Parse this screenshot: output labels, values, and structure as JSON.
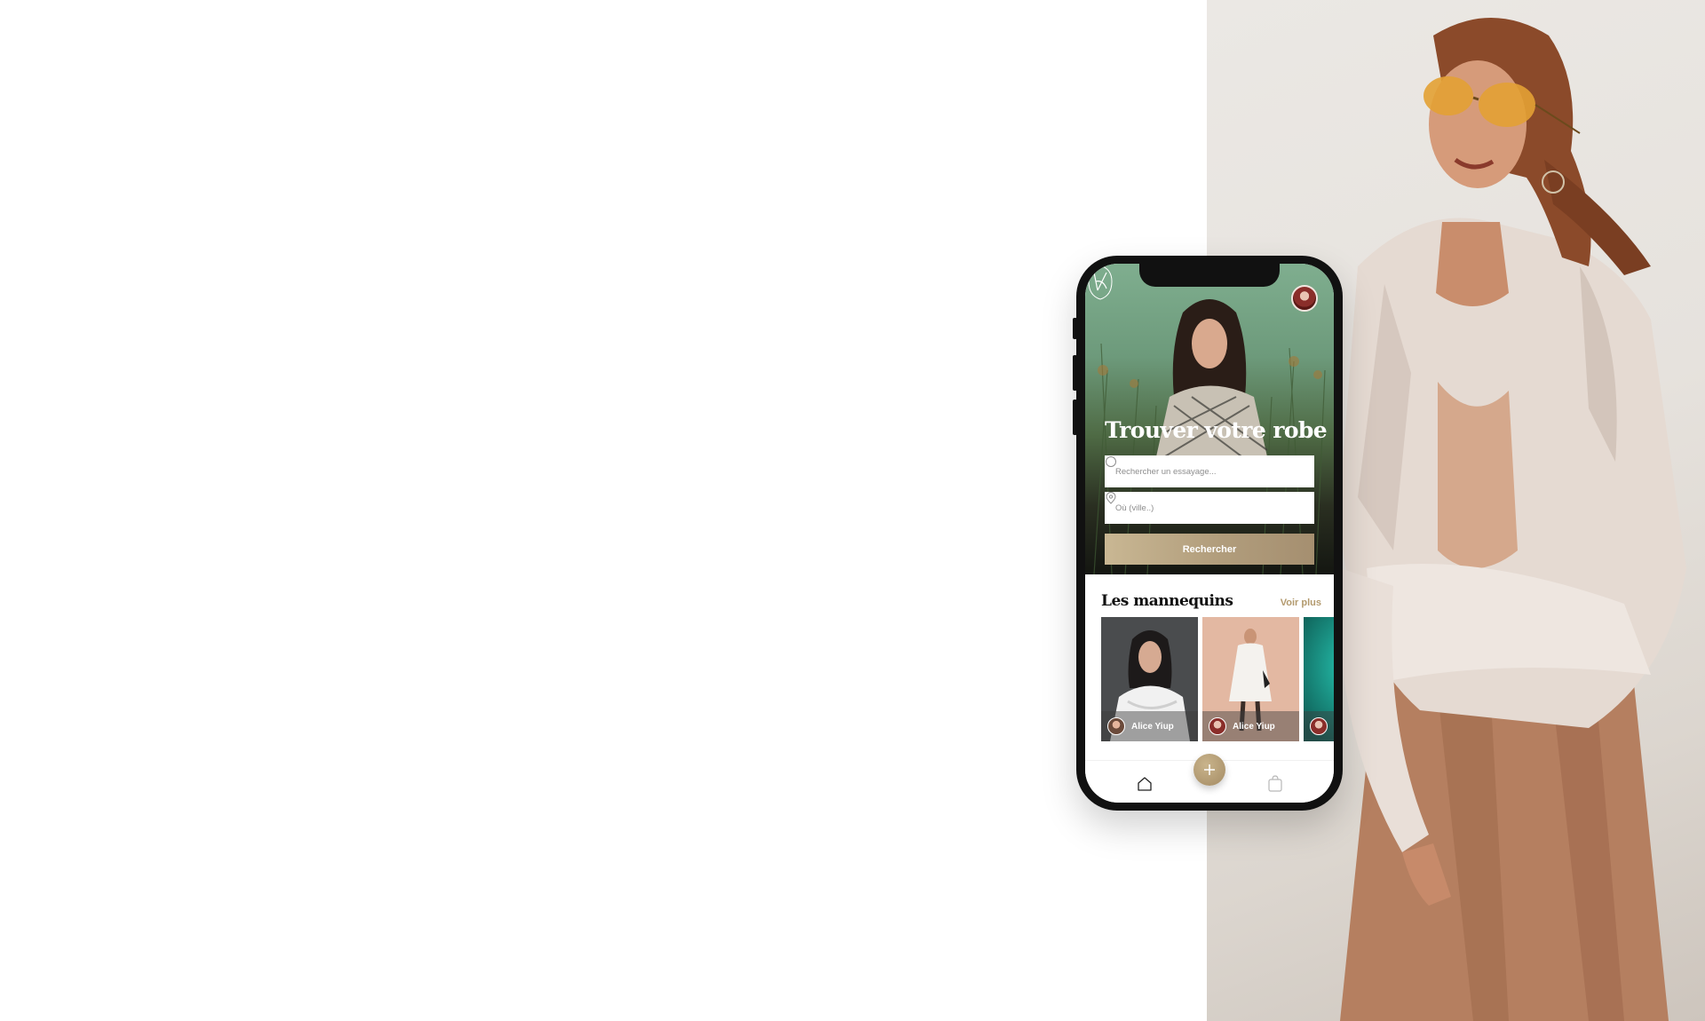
{
  "hero": {
    "title": "Trouver votre robe",
    "search_placeholder": "Rechercher un essayage...",
    "location_placeholder": "Où (ville..)",
    "search_button": "Rechercher"
  },
  "models": {
    "title": "Les mannequins",
    "see_more": "Voir plus",
    "items": [
      {
        "name": "Alice Yiup"
      },
      {
        "name": "Alice Yiup"
      },
      {
        "name": ""
      }
    ]
  },
  "tabbar": {
    "items": [
      "home-icon",
      "plus-icon",
      "shopping-bag-icon"
    ]
  },
  "colors": {
    "accent_gold": "#b39a6e",
    "button_gradient_start": "#c9b793",
    "button_gradient_end": "#a58f70",
    "hero_green": "#7fae8f"
  }
}
